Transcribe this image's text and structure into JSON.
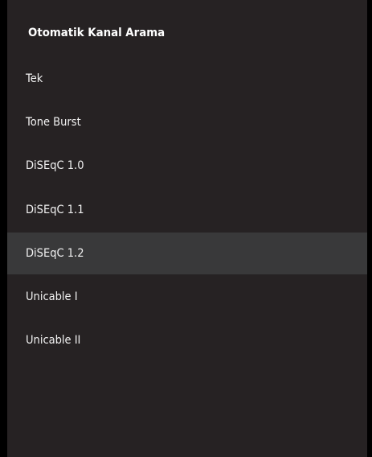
{
  "panel": {
    "title": "Otomatik Kanal Arama",
    "items": [
      {
        "label": "Tek"
      },
      {
        "label": "Tone Burst"
      },
      {
        "label": "DiSEqC 1.0"
      },
      {
        "label": "DiSEqC 1.1"
      },
      {
        "label": "DiSEqC 1.2",
        "selected": true
      },
      {
        "label": "Unicable I"
      },
      {
        "label": "Unicable II"
      }
    ]
  },
  "colors": {
    "panel_bg": "#262223",
    "selected_bg": "#39393a",
    "text": "#f2f2f2"
  }
}
